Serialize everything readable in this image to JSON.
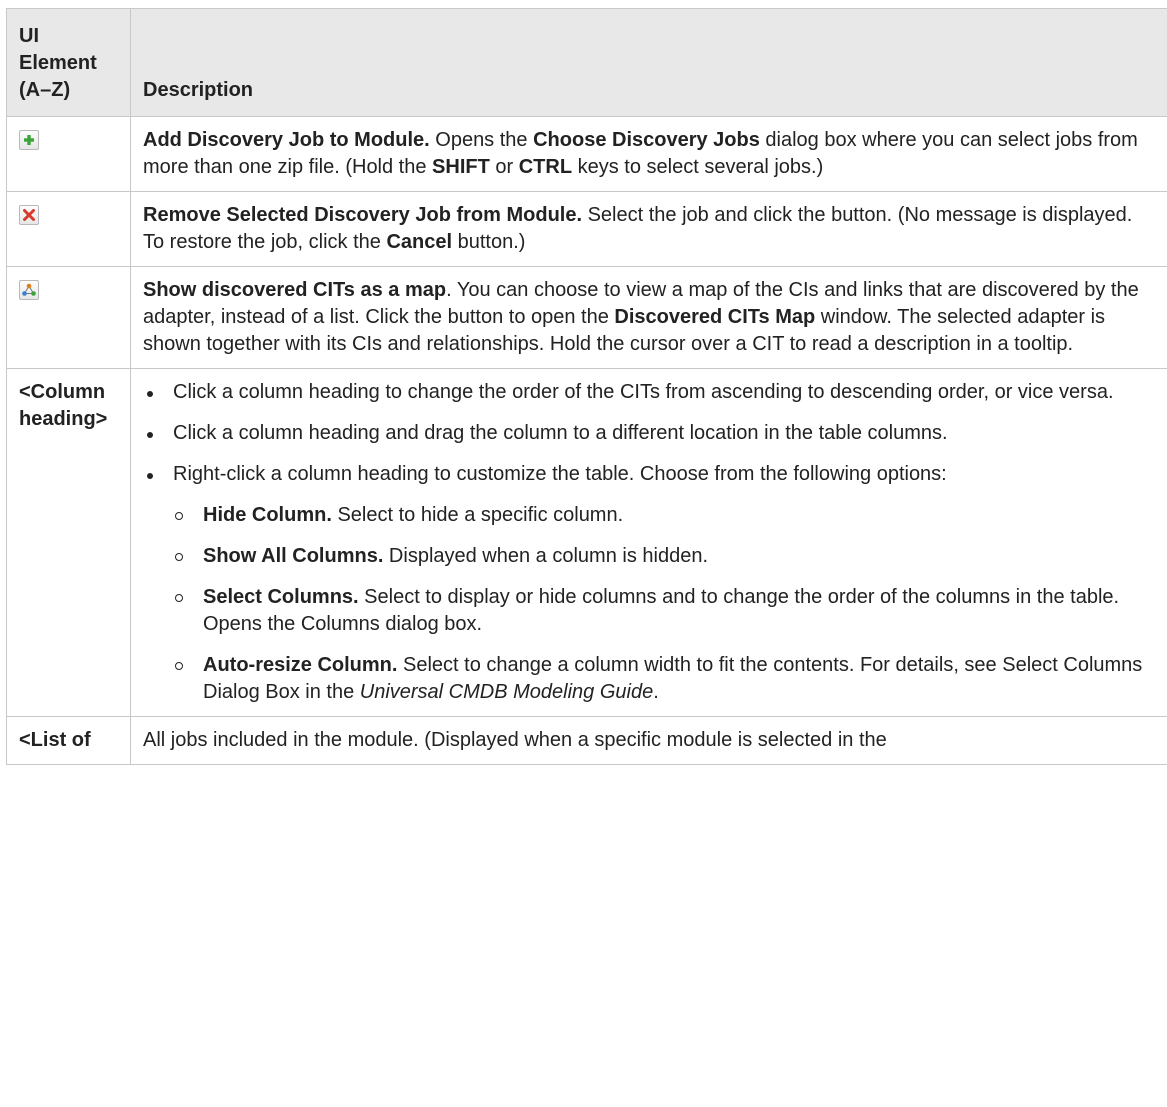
{
  "header": {
    "ui_element": "UI Element (A–Z)",
    "description": "Description"
  },
  "rows": [
    {
      "icon": "add-green-plus-icon",
      "title": "Add Discovery Job to Module.",
      "t1": " Opens the ",
      "b1": "Choose Discovery Jobs",
      "t2": " dialog box where you can select jobs from more than one zip file. (Hold the ",
      "b2": "SHIFT",
      "t3": " or ",
      "b3": "CTRL",
      "t4": " keys to select several jobs.)"
    },
    {
      "icon": "remove-red-x-icon",
      "title": "Remove Selected Discovery Job from Module.",
      "t1": " Select the job and click the button. (No message is displayed. To restore the job, click the ",
      "b1": "Cancel",
      "t2": " button.)"
    },
    {
      "icon": "cit-map-icon",
      "title": "Show discovered CITs as a map",
      "t1": ". You can choose to view a map of the CIs and links that are discovered by the adapter, instead of a list. Click the button to open the ",
      "b1": "Discovered CITs Map",
      "t2": " window. The selected adapter is shown together with its CIs and relationships. Hold the cursor over a CIT to read a description in a tooltip."
    },
    {
      "element": "<Column heading>",
      "bullets": [
        "Click a column heading to change the order of the CITs from ascending to descending order, or vice versa.",
        "Click a column heading and drag the column to a different location in the table columns.",
        "Right-click a column heading to customize the table. Choose from the following options:"
      ],
      "sub": [
        {
          "title": "Hide Column.",
          "text": " Select to hide a specific column."
        },
        {
          "title": "Show All Columns.",
          "text": " Displayed when a column is hidden."
        },
        {
          "title": "Select Columns.",
          "text": " Select to display or hide columns and to change the order of the columns in the table. Opens the Columns dialog box."
        },
        {
          "title": "Auto-resize Column.",
          "text": " Select to change a column width to fit the contents. For details, see Select Columns Dialog Box in the ",
          "italic": "Universal CMDB Modeling Guide",
          "end": "."
        }
      ]
    },
    {
      "element": "<List of",
      "text": "All jobs included in the module. (Displayed when a specific module is selected in the"
    }
  ],
  "colors": {
    "header_bg": "#e8e8e8",
    "border": "#c8c8c8",
    "text": "#222222",
    "add_green": "#3aa43a",
    "remove_red": "#d83a2a"
  }
}
